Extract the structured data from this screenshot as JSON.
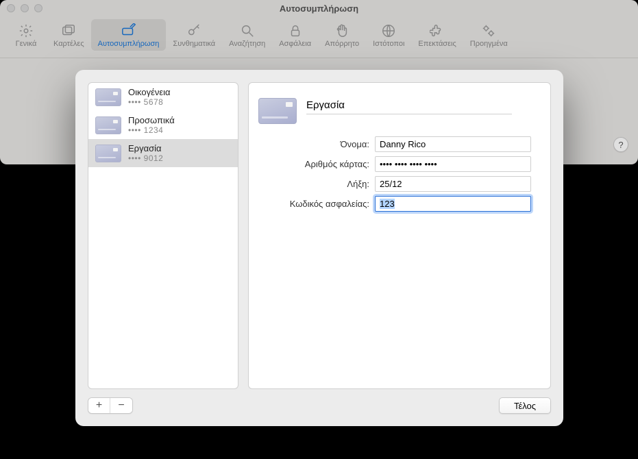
{
  "window": {
    "title": "Αυτοσυμπλήρωση"
  },
  "toolbar": {
    "items": [
      {
        "label": "Γενικά",
        "icon": "gear"
      },
      {
        "label": "Καρτέλες",
        "icon": "tabs"
      },
      {
        "label": "Αυτοσυμπλήρωση",
        "icon": "autofill"
      },
      {
        "label": "Συνθηματικά",
        "icon": "key"
      },
      {
        "label": "Αναζήτηση",
        "icon": "search"
      },
      {
        "label": "Ασφάλεια",
        "icon": "lock"
      },
      {
        "label": "Απόρρητο",
        "icon": "hand"
      },
      {
        "label": "Ιστότοποι",
        "icon": "globe"
      },
      {
        "label": "Επεκτάσεις",
        "icon": "puzzle"
      },
      {
        "label": "Προηγμένα",
        "icon": "gears"
      }
    ],
    "active_index": 2
  },
  "help_label": "?",
  "sidebar": {
    "cards": [
      {
        "title": "Οικογένεια",
        "masked": "•••• 5678"
      },
      {
        "title": "Προσωπικά",
        "masked": "•••• 1234"
      },
      {
        "title": "Εργασία",
        "masked": "•••• 9012"
      }
    ],
    "selected_index": 2
  },
  "detail": {
    "title_value": "Εργασία",
    "fields": {
      "name": {
        "label": "Όνομα:",
        "value": "Danny Rico"
      },
      "number": {
        "label": "Αριθμός κάρτας:",
        "value": "•••• •••• •••• ••••"
      },
      "expiry": {
        "label": "Λήξη:",
        "value": "25/12"
      },
      "security": {
        "label": "Κωδικός ασφαλείας:",
        "value": "123"
      }
    }
  },
  "controls": {
    "add": "+",
    "remove": "−",
    "done": "Τέλος"
  }
}
